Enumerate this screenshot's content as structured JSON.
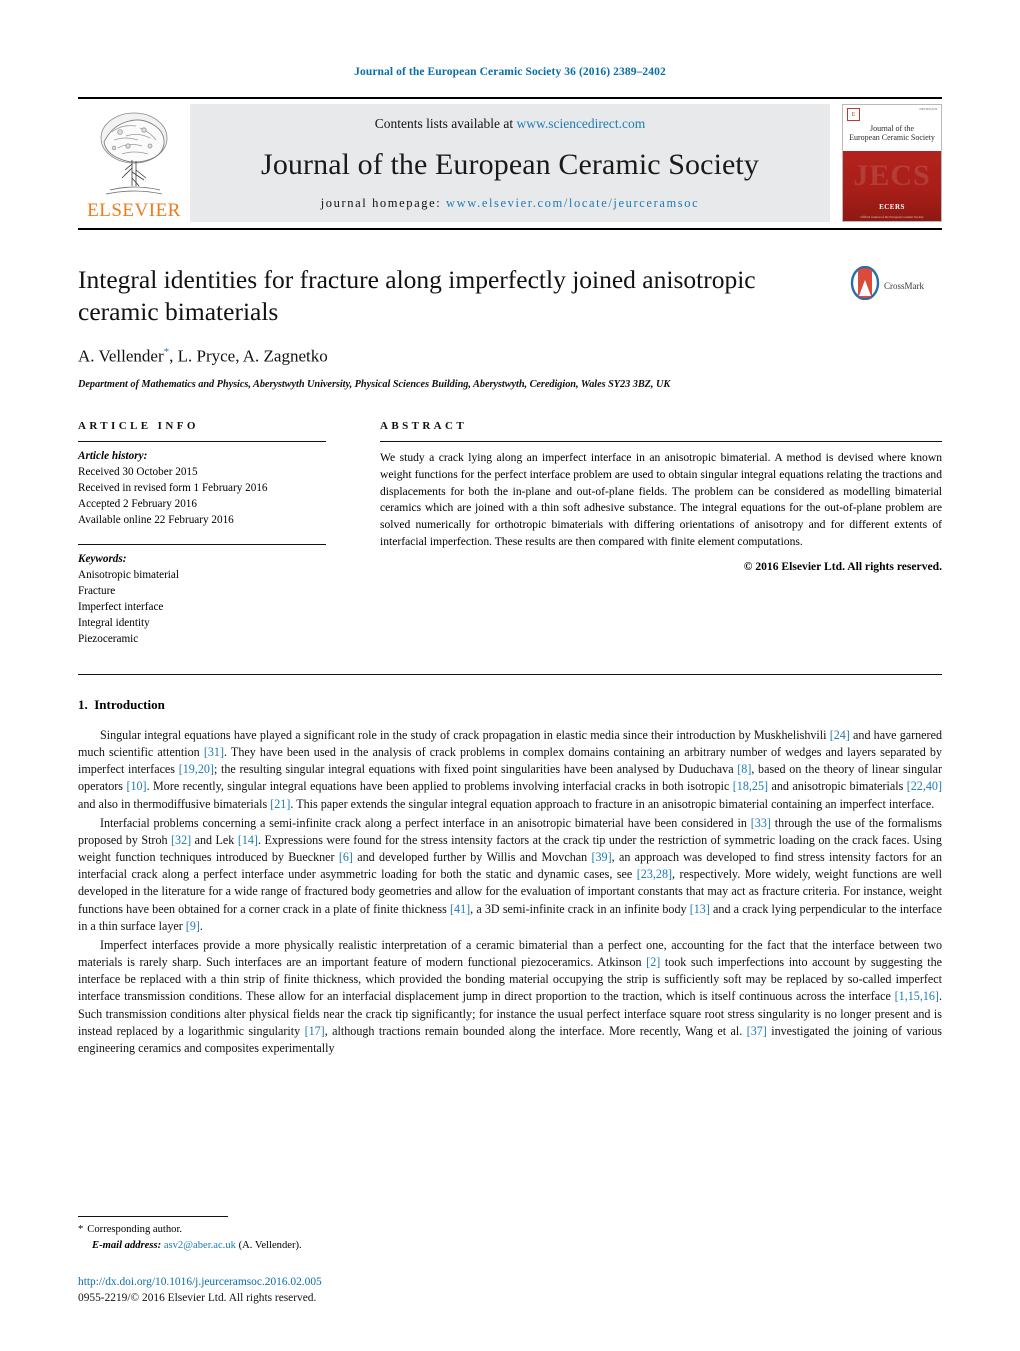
{
  "running_head": "Journal of the European Ceramic Society 36 (2016) 2389–2402",
  "masthead": {
    "publisher_name": "ELSEVIER",
    "contents_prefix": "Contents lists available at ",
    "contents_link": "www.sciencedirect.com",
    "journal_name": "Journal of the European Ceramic Society",
    "homepage_prefix": "journal homepage: ",
    "homepage_link": "www.elsevier.com/locate/jeurceramsoc",
    "cover": {
      "title": "Journal of the\nEuropean Ceramic Society",
      "ghost_text": "JECS",
      "society": "ECERS",
      "footer": "Official Journal of the European Ceramic Society"
    }
  },
  "article": {
    "title": "Integral identities for fracture along imperfectly joined anisotropic ceramic bimaterials",
    "authors": "A. Vellender",
    "authors_rest": ", L. Pryce, A. Zagnetko",
    "corresponding_marker": "*",
    "affiliation": "Department of Mathematics and Physics, Aberystwyth University, Physical Sciences Building, Aberystwyth, Ceredigion, Wales SY23 3BZ, UK",
    "crossmark_label": "CrossMark"
  },
  "article_info": {
    "heading": "ARTICLE INFO",
    "history_label": "Article history:",
    "history": [
      "Received 30 October 2015",
      "Received in revised form 1 February 2016",
      "Accepted 2 February 2016",
      "Available online 22 February 2016"
    ],
    "keywords_label": "Keywords:",
    "keywords": [
      "Anisotropic bimaterial",
      "Fracture",
      "Imperfect interface",
      "Integral identity",
      "Piezoceramic"
    ]
  },
  "abstract": {
    "heading": "ABSTRACT",
    "text": "We study a crack lying along an imperfect interface in an anisotropic bimaterial. A method is devised where known weight functions for the perfect interface problem are used to obtain singular integral equations relating the tractions and displacements for both the in-plane and out-of-plane fields. The problem can be considered as modelling bimaterial ceramics which are joined with a thin soft adhesive substance. The integral equations for the out-of-plane problem are solved numerically for orthotropic bimaterials with differing orientations of anisotropy and for different extents of interfacial imperfection. These results are then compared with finite element computations.",
    "copyright": "© 2016 Elsevier Ltd. All rights reserved."
  },
  "introduction": {
    "number": "1.",
    "heading": "Introduction",
    "paragraphs": [
      {
        "parts": [
          {
            "t": "Singular integral equations have played a significant role in the study of crack propagation in elastic media since their introduction by Muskhelishvili "
          },
          {
            "t": "[24]",
            "ref": true
          },
          {
            "t": " and have garnered much scientific attention "
          },
          {
            "t": "[31]",
            "ref": true
          },
          {
            "t": ". They have been used in the analysis of crack problems in complex domains containing an arbitrary number of wedges and layers separated by imperfect interfaces "
          },
          {
            "t": "[19,20]",
            "ref": true
          },
          {
            "t": "; the resulting singular integral equations with fixed point singularities have been analysed by Duduchava "
          },
          {
            "t": "[8]",
            "ref": true
          },
          {
            "t": ", based on the theory of linear singular operators "
          },
          {
            "t": "[10]",
            "ref": true
          },
          {
            "t": ". More recently, singular integral equations have been applied to problems involving interfacial cracks in both isotropic "
          },
          {
            "t": "[18,25]",
            "ref": true
          },
          {
            "t": " and anisotropic bimaterials "
          },
          {
            "t": "[22,40]",
            "ref": true
          },
          {
            "t": " and also in thermodiffusive bimaterials "
          },
          {
            "t": "[21]",
            "ref": true
          },
          {
            "t": ". This paper extends the singular integral equation approach to fracture in an anisotropic bimaterial containing an imperfect interface."
          }
        ]
      },
      {
        "parts": [
          {
            "t": "Interfacial problems concerning a semi-infinite crack along a perfect interface in an anisotropic bimaterial have been considered in "
          },
          {
            "t": "[33]",
            "ref": true
          },
          {
            "t": " through the use of the formalisms proposed by Stroh "
          },
          {
            "t": "[32]",
            "ref": true
          },
          {
            "t": " and Lek "
          },
          {
            "t": "[14]",
            "ref": true
          },
          {
            "t": ". Expressions were found for the stress intensity factors at the crack tip under the restriction of symmetric loading on the crack faces. Using weight function techniques introduced by Bueckner "
          },
          {
            "t": "[6]",
            "ref": true
          },
          {
            "t": " and developed further by Willis and Movchan "
          },
          {
            "t": "[39]",
            "ref": true
          },
          {
            "t": ", an approach was developed to find stress intensity factors for an interfacial crack along a perfect interface under asymmetric loading for both the static and dynamic cases, see "
          },
          {
            "t": "[23,28]",
            "ref": true
          },
          {
            "t": ", respectively. More widely, weight functions are well developed in the literature for a wide range of fractured body geometries and allow for the evaluation of important constants that may act as fracture criteria. For instance, weight functions have been obtained for a corner crack in a plate of finite thickness "
          },
          {
            "t": "[41]",
            "ref": true
          },
          {
            "t": ", a 3D semi-infinite crack in an infinite body "
          },
          {
            "t": "[13]",
            "ref": true
          },
          {
            "t": " and a crack lying perpendicular to the interface in a thin surface layer "
          },
          {
            "t": "[9]",
            "ref": true
          },
          {
            "t": "."
          }
        ]
      },
      {
        "parts": [
          {
            "t": "Imperfect interfaces provide a more physically realistic interpretation of a ceramic bimaterial than a perfect one, accounting for the fact that the interface between two materials is rarely sharp. Such interfaces are an important feature of modern functional piezoceramics. Atkinson "
          },
          {
            "t": "[2]",
            "ref": true
          },
          {
            "t": " took such imperfections into account by suggesting the interface be replaced with a thin strip of finite thickness, which provided the bonding material occupying the strip is sufficiently soft may be replaced by so-called imperfect interface transmission conditions. These allow for an interfacial displacement jump in direct proportion to the traction, which is itself continuous across the interface "
          },
          {
            "t": "[1,15,16]",
            "ref": true
          },
          {
            "t": ". Such transmission conditions alter physical fields near the crack tip significantly; for instance the usual perfect interface square root stress singularity is no longer present and is instead replaced by a logarithmic singularity "
          },
          {
            "t": "[17]",
            "ref": true
          },
          {
            "t": ", although tractions remain bounded along the interface. More recently, Wang et al. "
          },
          {
            "t": "[37]",
            "ref": true
          },
          {
            "t": " investigated the joining of various engineering ceramics and composites experimentally"
          }
        ]
      }
    ]
  },
  "footnote": {
    "star": "*",
    "corresponding": "Corresponding author.",
    "email_label": "E-mail address:",
    "email": "asv2@aber.ac.uk",
    "email_suffix": "(A. Vellender)."
  },
  "page_footer": {
    "doi": "http://dx.doi.org/10.1016/j.jeurceramsoc.2016.02.005",
    "issn": "0955-2219/© 2016 Elsevier Ltd. All rights reserved."
  },
  "colors": {
    "link": "#1f7bb6",
    "running_head": "#0a6ea8",
    "elsevier_orange": "#ee7b1a",
    "cover_red": "#b5261f"
  }
}
